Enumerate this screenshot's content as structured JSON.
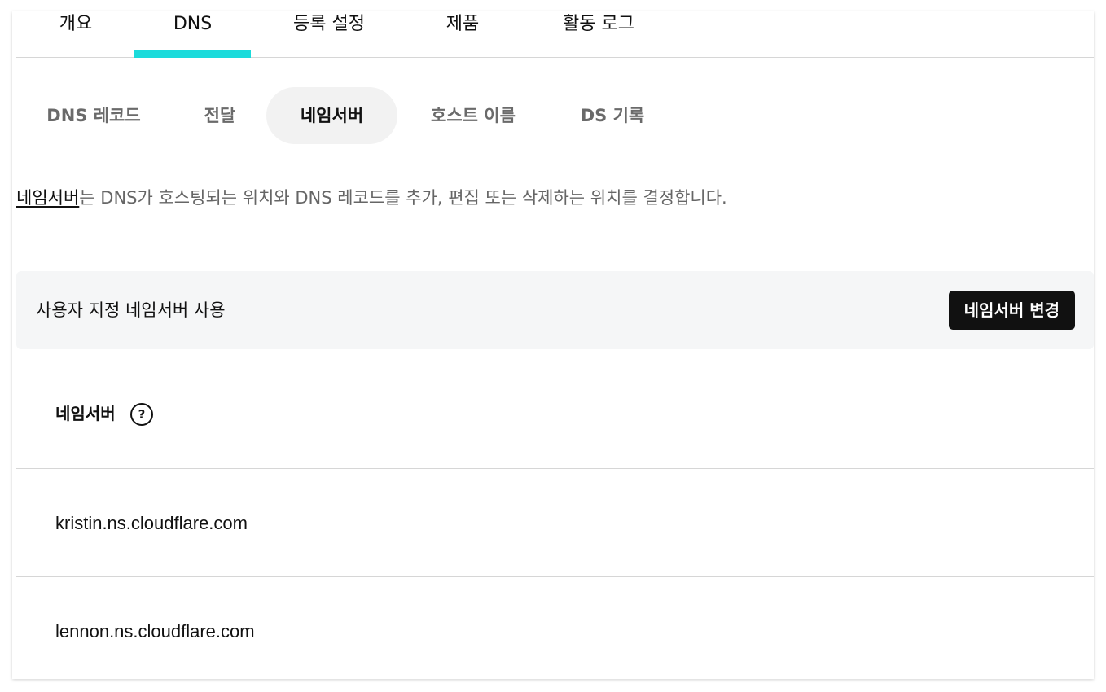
{
  "top_tabs": [
    {
      "label": "개요"
    },
    {
      "label": "DNS",
      "active": true
    },
    {
      "label": "등록 설정"
    },
    {
      "label": "제품"
    },
    {
      "label": "활동 로그"
    }
  ],
  "sub_tabs": [
    {
      "label": "DNS 레코드"
    },
    {
      "label": "전달"
    },
    {
      "label": "네임서버",
      "active": true
    },
    {
      "label": "호스트 이름"
    },
    {
      "label": "DS 기록"
    }
  ],
  "description": {
    "link_text": "네임서버",
    "rest_text": "는 DNS가 호스팅되는 위치와 DNS 레코드를 추가, 편집 또는 삭제하는 위치를 결정합니다."
  },
  "custom_panel": {
    "label": "사용자 지정 네임서버 사용",
    "button_label": "네임서버 변경"
  },
  "nameservers": {
    "header": "네임서버",
    "help_glyph": "?",
    "items": [
      "kristin.ns.cloudflare.com",
      "lennon.ns.cloudflare.com"
    ]
  },
  "colors": {
    "active_tab_indicator": "#1bdbdb",
    "button_bg": "#111111",
    "panel_bg": "#f5f6f7"
  }
}
